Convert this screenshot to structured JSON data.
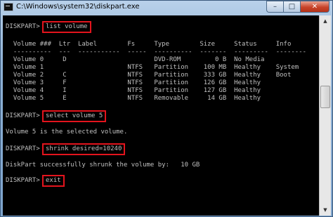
{
  "window": {
    "title": "C:\\Windows\\system32\\diskpart.exe",
    "min_glyph": "–",
    "max_glyph": "□",
    "close_glyph": "✕"
  },
  "prompt": "DISKPART>",
  "commands": {
    "list": "list volume",
    "select": "select volume 5",
    "shrink": "shrink desired=10240",
    "exit": "exit"
  },
  "volume_table": {
    "header": "  Volume ###  Ltr  Label        Fs     Type        Size     Status     Info",
    "separator": "  ----------  ---  -----------  -----  ----------  -------  ---------  --------",
    "rows": [
      "  Volume 0     D                       DVD-ROM         0 B  No Media",
      "  Volume 1                      NTFS   Partition    100 MB  Healthy    System",
      "  Volume 2     C                NTFS   Partition    333 GB  Healthy    Boot",
      "  Volume 3     F                NTFS   Partition    126 GB  Healthy",
      "  Volume 4     I                NTFS   Partition    127 GB  Healthy",
      "  Volume 5     E                NTFS   Removable     14 GB  Healthy"
    ]
  },
  "messages": {
    "selected": "Volume 5 is the selected volume.",
    "shrunk": "DiskPart successfully shrunk the volume by:   10 GB"
  },
  "scrollbar": {
    "up_glyph": "▲",
    "down_glyph": "▼"
  }
}
